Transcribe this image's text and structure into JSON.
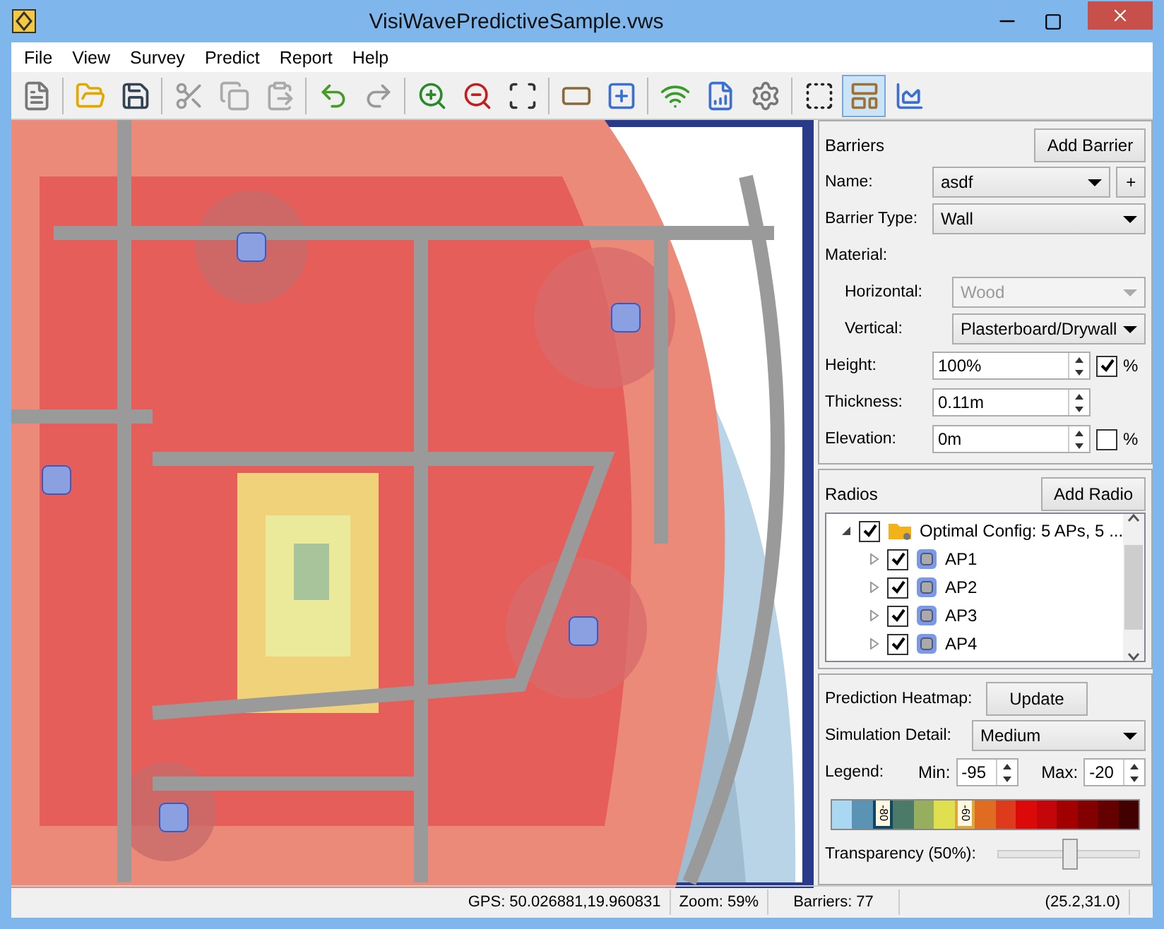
{
  "window": {
    "title": "VisiWavePredictiveSample.vws"
  },
  "menu": [
    "File",
    "View",
    "Survey",
    "Predict",
    "Report",
    "Help"
  ],
  "toolbar": [
    {
      "kind": "button",
      "selected": false
    },
    {
      "kind": "separator"
    },
    {
      "kind": "button",
      "selected": false
    },
    {
      "kind": "button",
      "selected": false
    },
    {
      "kind": "separator"
    },
    {
      "kind": "button",
      "selected": false
    },
    {
      "kind": "button",
      "selected": false
    },
    {
      "kind": "button",
      "selected": false
    },
    {
      "kind": "separator"
    },
    {
      "kind": "button",
      "selected": false
    },
    {
      "kind": "button",
      "selected": false
    },
    {
      "kind": "separator"
    },
    {
      "kind": "button",
      "selected": false
    },
    {
      "kind": "button",
      "selected": false
    },
    {
      "kind": "button",
      "selected": false
    },
    {
      "kind": "separator"
    },
    {
      "kind": "button",
      "selected": false
    },
    {
      "kind": "button",
      "selected": false
    },
    {
      "kind": "separator"
    },
    {
      "kind": "button",
      "selected": false
    },
    {
      "kind": "button",
      "selected": false
    },
    {
      "kind": "button",
      "selected": false
    },
    {
      "kind": "separator"
    },
    {
      "kind": "button",
      "selected": false
    },
    {
      "kind": "button",
      "selected": true
    },
    {
      "kind": "button",
      "selected": false
    }
  ],
  "barriers": {
    "title": "Barriers",
    "add_button": "Add Barrier",
    "add_button_disabled": false,
    "name_label": "Name:",
    "name_value": "asdf",
    "plus_button": "+",
    "type_label": "Barrier Type:",
    "type_value": "Wall",
    "material_label": "Material:",
    "horizontal_label": "Horizontal:",
    "horizontal_value": "Wood",
    "horizontal_disabled": true,
    "vertical_label": "Vertical:",
    "vertical_value": "Plasterboard/Drywall",
    "height_label": "Height:",
    "height_value": "100%",
    "height_percent": {
      "label": "%",
      "checked": true
    },
    "thickness_label": "Thickness:",
    "thickness_value": "0.11m",
    "elevation_label": "Elevation:",
    "elevation_value": "0m",
    "elevation_percent": {
      "label": "%",
      "checked": false
    }
  },
  "radios": {
    "title": "Radios",
    "add_button": "Add Radio",
    "add_button_disabled": false,
    "tree": [
      {
        "label": "Optimal Config: 5 APs, 5 ...",
        "checked": true,
        "expanded": true,
        "children": [
          {
            "label": "AP1",
            "checked": true,
            "expanded": false
          },
          {
            "label": "AP2",
            "checked": true,
            "expanded": false
          },
          {
            "label": "AP3",
            "checked": true,
            "expanded": false
          },
          {
            "label": "AP4",
            "checked": true,
            "expanded": false
          }
        ]
      }
    ]
  },
  "heatmap": {
    "prediction_label": "Prediction Heatmap:",
    "update_button": "Update",
    "detail_label": "Simulation Detail:",
    "detail_value": "Medium",
    "legend_label": "Legend:",
    "min_label": "Min:",
    "min_value": "-95",
    "max_label": "Max:",
    "max_value": "-20",
    "legend": [
      {
        "color": "#aad8f2"
      },
      {
        "color": "#5b93b5"
      },
      {
        "color": "#0f4666",
        "marker": "-80"
      },
      {
        "color": "#4c7a68"
      },
      {
        "color": "#97ae5e"
      },
      {
        "color": "#e0df50"
      },
      {
        "color": "#dea63c",
        "marker": "-60"
      },
      {
        "color": "#e06c22"
      },
      {
        "color": "#de3a1c"
      },
      {
        "color": "#db0a08"
      },
      {
        "color": "#c4050a"
      },
      {
        "color": "#a20000"
      },
      {
        "color": "#820000"
      },
      {
        "color": "#640000"
      },
      {
        "color": "#420000"
      }
    ],
    "transparency_label": "Transparency (50%):",
    "transparency": {
      "level": 0.5
    }
  },
  "status_bar": {
    "gps": "GPS: 50.026881,19.960831",
    "zoom": "Zoom: 59%",
    "barriers": "Barriers: 77",
    "coords": "(25.2,31.0)"
  }
}
